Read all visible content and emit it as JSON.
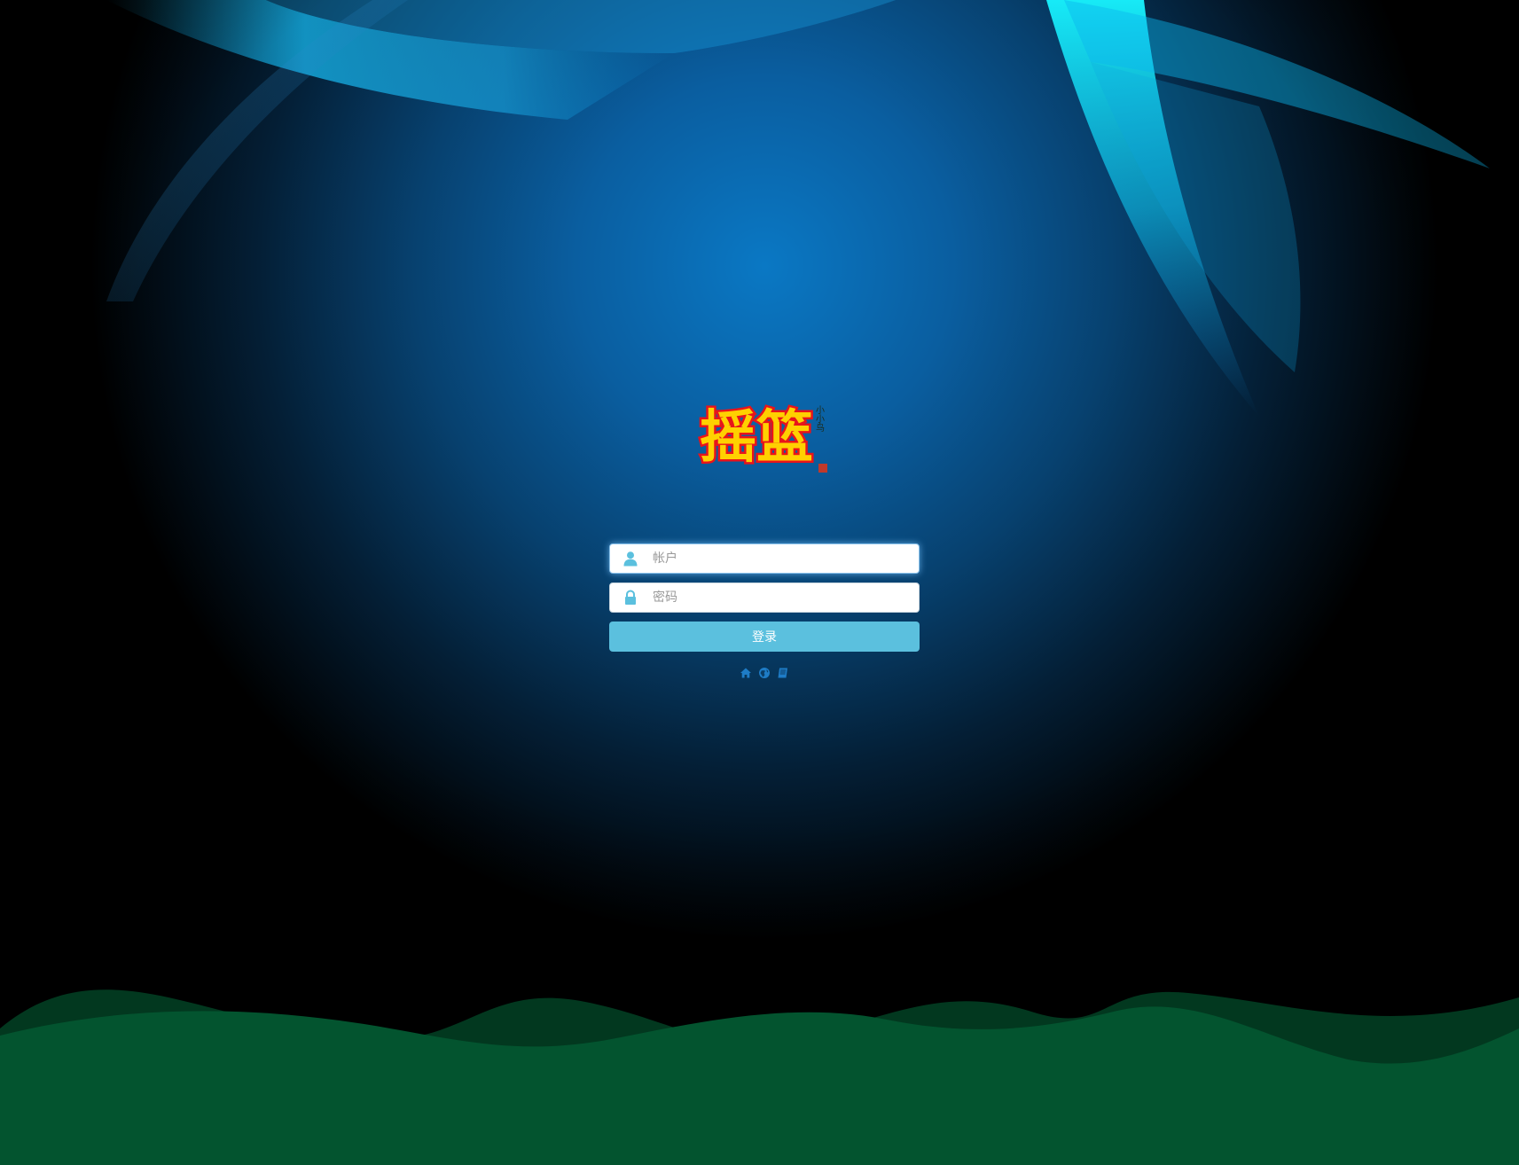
{
  "logo": {
    "text_main": "摇篮",
    "text_side": "小小鸟"
  },
  "login": {
    "account_placeholder": "帐户",
    "password_placeholder": "密码",
    "submit_label": "登录"
  },
  "icons": {
    "account": "user-icon",
    "password": "lock-icon",
    "links": [
      "home-icon",
      "globe-icon",
      "book-icon"
    ]
  },
  "colors": {
    "button": "#5bc0de",
    "icon": "#5bc0de",
    "link_icon": "#1e7cc6",
    "wave_front": "#03542f",
    "wave_back": "#02381f"
  }
}
